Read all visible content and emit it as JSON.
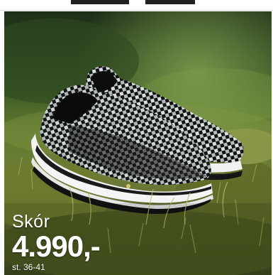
{
  "product": {
    "title": "Skór",
    "price": "4.990,-",
    "sizes": "st. 36-41"
  },
  "colors": {
    "text": "#ffffff",
    "grass_dark": "#26391c",
    "grass_light": "#7a8c3a",
    "shoe_black": "#141414",
    "shoe_weave_light": "#c9d1d1",
    "sole": "#f2f2f2"
  }
}
